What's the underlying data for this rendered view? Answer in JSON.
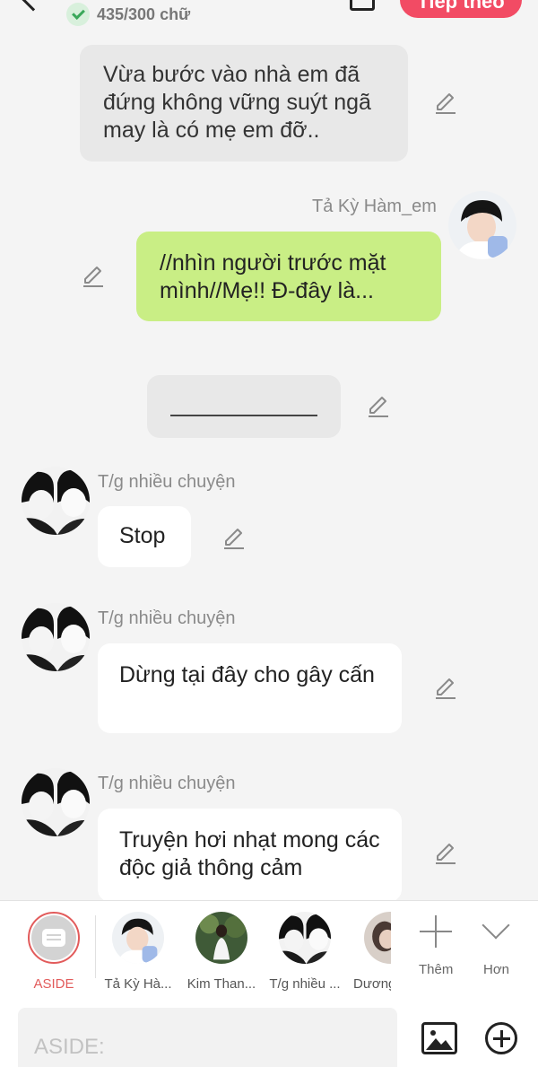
{
  "header": {
    "char_count": "435/300 chữ",
    "next_label": "Tiếp theo"
  },
  "messages": [
    {
      "type": "narration",
      "text": "Vừa bước vào nhà em đã đứng không vững suýt ngã may là có mẹ em đỡ.."
    },
    {
      "type": "right",
      "sender": "Tả Kỳ Hàm_em",
      "text": "//nhìn người trước mặt mình//Mẹ!! Đ-đây là..."
    },
    {
      "type": "divider",
      "text": ""
    },
    {
      "type": "left",
      "sender": "T/g nhiều chuyện",
      "text": "Stop"
    },
    {
      "type": "left",
      "sender": "T/g nhiều chuyện",
      "text": "Dừng tại đây cho gây cấn"
    },
    {
      "type": "left",
      "sender": "T/g nhiều chuyện",
      "text": "Truyện hơi nhạt mong các độc giả thông cảm"
    }
  ],
  "characters": [
    {
      "label": "ASIDE",
      "icon": "aside-icon",
      "selected": true,
      "color": "#e25b5b"
    },
    {
      "label": "Tả Kỳ Hà..."
    },
    {
      "label": "Kim Than..."
    },
    {
      "label": "T/g nhiều ..."
    },
    {
      "label": "Dương"
    }
  ],
  "char_actions": {
    "more_label": "Thêm",
    "other_label": "Hơn"
  },
  "input": {
    "placeholder": "ASIDE:"
  },
  "colors": {
    "accent": "#f24b64",
    "right_bubble": "#c9ee85",
    "narration_bubble": "#e8e8e8",
    "background": "#f4f4f4"
  }
}
